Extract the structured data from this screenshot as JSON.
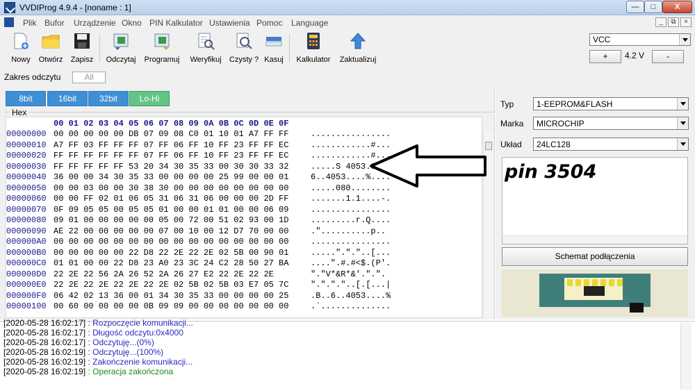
{
  "window": {
    "title": "VVDIProg 4.9.4 - [noname : 1]",
    "controls": {
      "minimize": "—",
      "maximize": "□",
      "close": "X"
    }
  },
  "menu": {
    "items": [
      "Plik",
      "Bufor",
      "Urządzenie",
      "Okno",
      "PIN Kalkulator",
      "Ustawienia",
      "Pomoc",
      "Language"
    ],
    "mdi": [
      "_",
      "⧉",
      "×"
    ]
  },
  "toolbar": {
    "new": "Nowy",
    "open": "Otwórz",
    "save": "Zapisz",
    "read": "Odczytaj",
    "program": "Programuj",
    "verify": "Weryfikuj",
    "blank": "Czysty ?",
    "erase": "Kasuj",
    "calculator": "Kalkulator",
    "update": "Zaktualizuj"
  },
  "power": {
    "vcc": "VCC",
    "plus": "+",
    "voltage": "4.2 V",
    "minus": "-"
  },
  "range": {
    "label": "Zakres odczytu",
    "value": "All"
  },
  "modes": [
    "8bit",
    "16bit",
    "32bit",
    "Lo-Hi"
  ],
  "hex": {
    "group_label": "Hex",
    "header": "00 01 02 03 04 05 06 07 08 09 0A 0B 0C 0D 0E 0F",
    "rows": [
      {
        "addr": "00000000",
        "bytes": "00 00 00 00 00 DB 07 09 08 C0 01 10 01 A7 FF FF",
        "ascii": "................"
      },
      {
        "addr": "00000010",
        "bytes": "A7 FF 03 FF FF FF 07 FF 06 FF 10 FF 23 FF FF EC",
        "ascii": "............#..."
      },
      {
        "addr": "00000020",
        "bytes": "FF FF FF FF FF FF 07 FF 06 FF 10 FF 23 FF FF EC",
        "ascii": "............#..."
      },
      {
        "addr": "00000030",
        "bytes": "FF FF FF FF FF 53 20 34 30 35 33 00 30 30 33 32",
        "ascii": ".....S 4053.0032"
      },
      {
        "addr": "00000040",
        "bytes": "36 00 00 34 30 35 33 00 00 00 00 25 99 00 00 01",
        "ascii": "6..4053....%...."
      },
      {
        "addr": "00000050",
        "bytes": "00 00 03 00 00 30 38 30 00 00 00 00 00 00 00 00",
        "ascii": ".....080........"
      },
      {
        "addr": "00000060",
        "bytes": "00 00 FF 02 01 06 05 31 06 31 06 00 00 00 2D FF",
        "ascii": ".......1.1....-."
      },
      {
        "addr": "00000070",
        "bytes": "0F 09 05 05 00 05 05 01 00 00 01 01 00 00 06 09",
        "ascii": "................"
      },
      {
        "addr": "00000080",
        "bytes": "09 01 00 00 00 00 00 05 00 72 00 51 02 93 00 1D",
        "ascii": ".........r.Q...."
      },
      {
        "addr": "00000090",
        "bytes": "AE 22 00 00 00 00 00 07 00 10 00 12 D7 70 00 00",
        "ascii": ".\"..........p.."
      },
      {
        "addr": "000000A0",
        "bytes": "00 00 00 00 00 00 00 00 00 00 00 00 00 00 00 00",
        "ascii": "................"
      },
      {
        "addr": "000000B0",
        "bytes": "00 00 00 00 00 22 D8 22 2E 22 2E 02 5B 00 90 01",
        "ascii": ".....\".\".\"..[..."
      },
      {
        "addr": "000000C0",
        "bytes": "01 01 00 00 22 D8 23 A0 23 3C 24 C2 28 50 27 BA",
        "ascii": "....\".#.#<$.(P'."
      },
      {
        "addr": "000000D0",
        "bytes": "22 2E 22 56 2A 26 52 2A 26 27 E2 22 2E 22 2E",
        "ascii": "\".\"V*&R*&'.\".\"."
      },
      {
        "addr": "000000E0",
        "bytes": "22 2E 22 2E 22 2E 22 2E 02 5B 02 5B 03 E7 05 7C",
        "ascii": "\".\".\".\"..[.[...|"
      },
      {
        "addr": "000000F0",
        "bytes": "06 42 02 13 36 00 01 34 30 35 33 00 00 00 00 25",
        "ascii": ".B..6..4053....%"
      },
      {
        "addr": "00000100",
        "bytes": "00 60 00 00 00 00 0B 09 09 00 00 00 00 00 00 00",
        "ascii": ".`.............."
      }
    ]
  },
  "chip": {
    "type_label": "Typ",
    "type_value": "1-EEPROM&FLASH",
    "brand_label": "Marka",
    "brand_value": "MICROCHIP",
    "model_label": "Układ",
    "model_value": "24LC128",
    "note": "pin 3504",
    "schematic_button": "Schemat podłączenia"
  },
  "log": [
    {
      "ts": "[2020-05-28 16:02:17]",
      "msg": ": Rozpoczęcie komunikacji...",
      "kind": "info"
    },
    {
      "ts": "[2020-05-28 16:02:17]",
      "msg": ": Długość odczytu:0x4000",
      "kind": "info"
    },
    {
      "ts": "[2020-05-28 16:02:17]",
      "msg": ": Odczytuję...(0%)",
      "kind": "info"
    },
    {
      "ts": "[2020-05-28 16:02:19]",
      "msg": ": Odczytuję...(100%)",
      "kind": "info"
    },
    {
      "ts": "[2020-05-28 16:02:19]",
      "msg": ": Zakończenie komunikacji...",
      "kind": "info"
    },
    {
      "ts": "[2020-05-28 16:02:19]",
      "msg": ": Operacja zakończona",
      "kind": "ok"
    }
  ],
  "colors": {
    "mode_blue": "#3e8fd4",
    "mode_green": "#65c387",
    "hex_header": "#16168c",
    "log_info": "#2a2ac0",
    "log_ok": "#1a8a1a"
  }
}
